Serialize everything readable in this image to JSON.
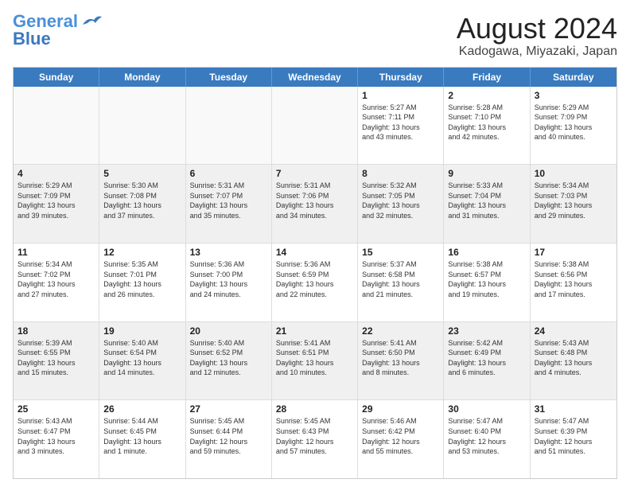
{
  "header": {
    "logo_line1": "General",
    "logo_line2": "Blue",
    "title": "August 2024",
    "subtitle": "Kadogawa, Miyazaki, Japan"
  },
  "calendar": {
    "days_of_week": [
      "Sunday",
      "Monday",
      "Tuesday",
      "Wednesday",
      "Thursday",
      "Friday",
      "Saturday"
    ],
    "rows": [
      [
        {
          "day": "",
          "info": ""
        },
        {
          "day": "",
          "info": ""
        },
        {
          "day": "",
          "info": ""
        },
        {
          "day": "",
          "info": ""
        },
        {
          "day": "1",
          "info": "Sunrise: 5:27 AM\nSunset: 7:11 PM\nDaylight: 13 hours\nand 43 minutes."
        },
        {
          "day": "2",
          "info": "Sunrise: 5:28 AM\nSunset: 7:10 PM\nDaylight: 13 hours\nand 42 minutes."
        },
        {
          "day": "3",
          "info": "Sunrise: 5:29 AM\nSunset: 7:09 PM\nDaylight: 13 hours\nand 40 minutes."
        }
      ],
      [
        {
          "day": "4",
          "info": "Sunrise: 5:29 AM\nSunset: 7:09 PM\nDaylight: 13 hours\nand 39 minutes."
        },
        {
          "day": "5",
          "info": "Sunrise: 5:30 AM\nSunset: 7:08 PM\nDaylight: 13 hours\nand 37 minutes."
        },
        {
          "day": "6",
          "info": "Sunrise: 5:31 AM\nSunset: 7:07 PM\nDaylight: 13 hours\nand 35 minutes."
        },
        {
          "day": "7",
          "info": "Sunrise: 5:31 AM\nSunset: 7:06 PM\nDaylight: 13 hours\nand 34 minutes."
        },
        {
          "day": "8",
          "info": "Sunrise: 5:32 AM\nSunset: 7:05 PM\nDaylight: 13 hours\nand 32 minutes."
        },
        {
          "day": "9",
          "info": "Sunrise: 5:33 AM\nSunset: 7:04 PM\nDaylight: 13 hours\nand 31 minutes."
        },
        {
          "day": "10",
          "info": "Sunrise: 5:34 AM\nSunset: 7:03 PM\nDaylight: 13 hours\nand 29 minutes."
        }
      ],
      [
        {
          "day": "11",
          "info": "Sunrise: 5:34 AM\nSunset: 7:02 PM\nDaylight: 13 hours\nand 27 minutes."
        },
        {
          "day": "12",
          "info": "Sunrise: 5:35 AM\nSunset: 7:01 PM\nDaylight: 13 hours\nand 26 minutes."
        },
        {
          "day": "13",
          "info": "Sunrise: 5:36 AM\nSunset: 7:00 PM\nDaylight: 13 hours\nand 24 minutes."
        },
        {
          "day": "14",
          "info": "Sunrise: 5:36 AM\nSunset: 6:59 PM\nDaylight: 13 hours\nand 22 minutes."
        },
        {
          "day": "15",
          "info": "Sunrise: 5:37 AM\nSunset: 6:58 PM\nDaylight: 13 hours\nand 21 minutes."
        },
        {
          "day": "16",
          "info": "Sunrise: 5:38 AM\nSunset: 6:57 PM\nDaylight: 13 hours\nand 19 minutes."
        },
        {
          "day": "17",
          "info": "Sunrise: 5:38 AM\nSunset: 6:56 PM\nDaylight: 13 hours\nand 17 minutes."
        }
      ],
      [
        {
          "day": "18",
          "info": "Sunrise: 5:39 AM\nSunset: 6:55 PM\nDaylight: 13 hours\nand 15 minutes."
        },
        {
          "day": "19",
          "info": "Sunrise: 5:40 AM\nSunset: 6:54 PM\nDaylight: 13 hours\nand 14 minutes."
        },
        {
          "day": "20",
          "info": "Sunrise: 5:40 AM\nSunset: 6:52 PM\nDaylight: 13 hours\nand 12 minutes."
        },
        {
          "day": "21",
          "info": "Sunrise: 5:41 AM\nSunset: 6:51 PM\nDaylight: 13 hours\nand 10 minutes."
        },
        {
          "day": "22",
          "info": "Sunrise: 5:41 AM\nSunset: 6:50 PM\nDaylight: 13 hours\nand 8 minutes."
        },
        {
          "day": "23",
          "info": "Sunrise: 5:42 AM\nSunset: 6:49 PM\nDaylight: 13 hours\nand 6 minutes."
        },
        {
          "day": "24",
          "info": "Sunrise: 5:43 AM\nSunset: 6:48 PM\nDaylight: 13 hours\nand 4 minutes."
        }
      ],
      [
        {
          "day": "25",
          "info": "Sunrise: 5:43 AM\nSunset: 6:47 PM\nDaylight: 13 hours\nand 3 minutes."
        },
        {
          "day": "26",
          "info": "Sunrise: 5:44 AM\nSunset: 6:45 PM\nDaylight: 13 hours\nand 1 minute."
        },
        {
          "day": "27",
          "info": "Sunrise: 5:45 AM\nSunset: 6:44 PM\nDaylight: 12 hours\nand 59 minutes."
        },
        {
          "day": "28",
          "info": "Sunrise: 5:45 AM\nSunset: 6:43 PM\nDaylight: 12 hours\nand 57 minutes."
        },
        {
          "day": "29",
          "info": "Sunrise: 5:46 AM\nSunset: 6:42 PM\nDaylight: 12 hours\nand 55 minutes."
        },
        {
          "day": "30",
          "info": "Sunrise: 5:47 AM\nSunset: 6:40 PM\nDaylight: 12 hours\nand 53 minutes."
        },
        {
          "day": "31",
          "info": "Sunrise: 5:47 AM\nSunset: 6:39 PM\nDaylight: 12 hours\nand 51 minutes."
        }
      ]
    ]
  }
}
